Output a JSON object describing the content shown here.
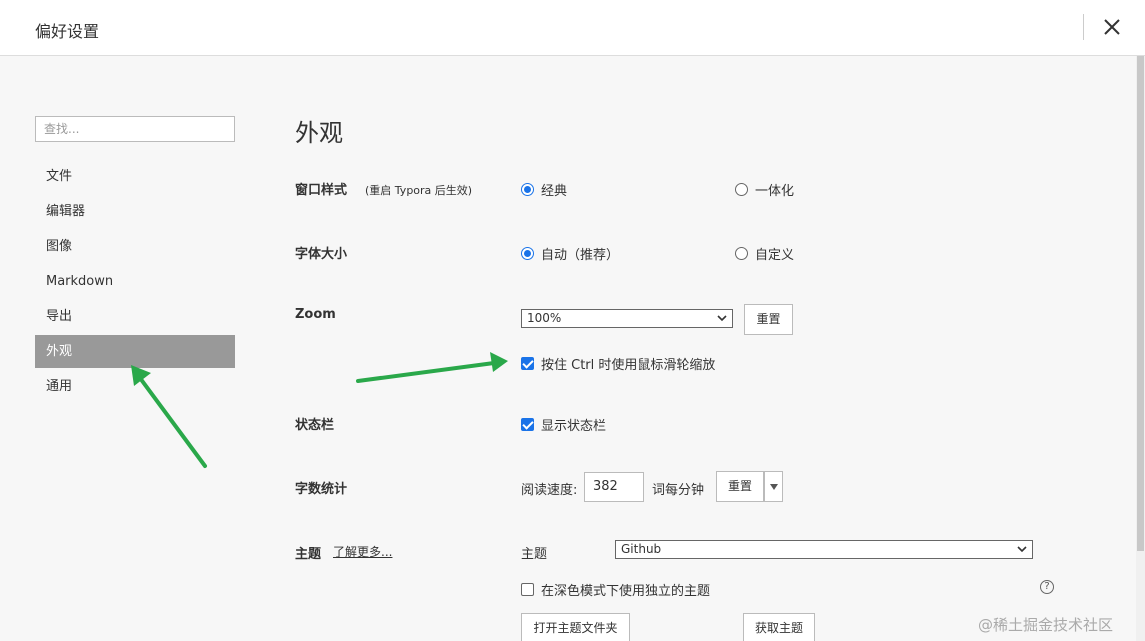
{
  "window": {
    "title": "偏好设置",
    "close_icon": "close-icon"
  },
  "sidebar": {
    "search_placeholder": "查找...",
    "items": [
      {
        "label": "文件",
        "active": false
      },
      {
        "label": "编辑器",
        "active": false
      },
      {
        "label": "图像",
        "active": false
      },
      {
        "label": "Markdown",
        "active": false
      },
      {
        "label": "导出",
        "active": false
      },
      {
        "label": "外观",
        "active": true
      },
      {
        "label": "通用",
        "active": false
      }
    ]
  },
  "main": {
    "heading": "外观",
    "window_style": {
      "label": "窗口样式",
      "note": "(重启 Typora 后生效)",
      "options": [
        {
          "label": "经典",
          "checked": true
        },
        {
          "label": "一体化",
          "checked": false
        }
      ]
    },
    "font_size": {
      "label": "字体大小",
      "options": [
        {
          "label": "自动（推荐）",
          "checked": true
        },
        {
          "label": "自定义",
          "checked": false
        }
      ]
    },
    "zoom": {
      "label": "Zoom",
      "value": "100%",
      "reset_label": "重置",
      "ctrl_wheel_label": "按住 Ctrl 时使用鼠标滑轮缩放",
      "ctrl_wheel_checked": true
    },
    "status_bar": {
      "label": "状态栏",
      "show_label": "显示状态栏",
      "show_checked": true
    },
    "word_count": {
      "label": "字数统计",
      "speed_label": "阅读速度:",
      "speed_value": "382",
      "unit": "词每分钟",
      "reset_label": "重置"
    },
    "theme": {
      "label": "主题",
      "learn_more": "了解更多...",
      "field_label": "主题",
      "value": "Github",
      "dark_label": "在深色模式下使用独立的主题",
      "dark_checked": false,
      "open_folder_label": "打开主题文件夹",
      "get_themes_label": "获取主题",
      "help_icon": "question-icon"
    }
  },
  "watermark": "@稀土掘金技术社区",
  "colors": {
    "accent": "#1a73e8",
    "active_nav": "#999999",
    "arrow": "#2aa84a"
  }
}
